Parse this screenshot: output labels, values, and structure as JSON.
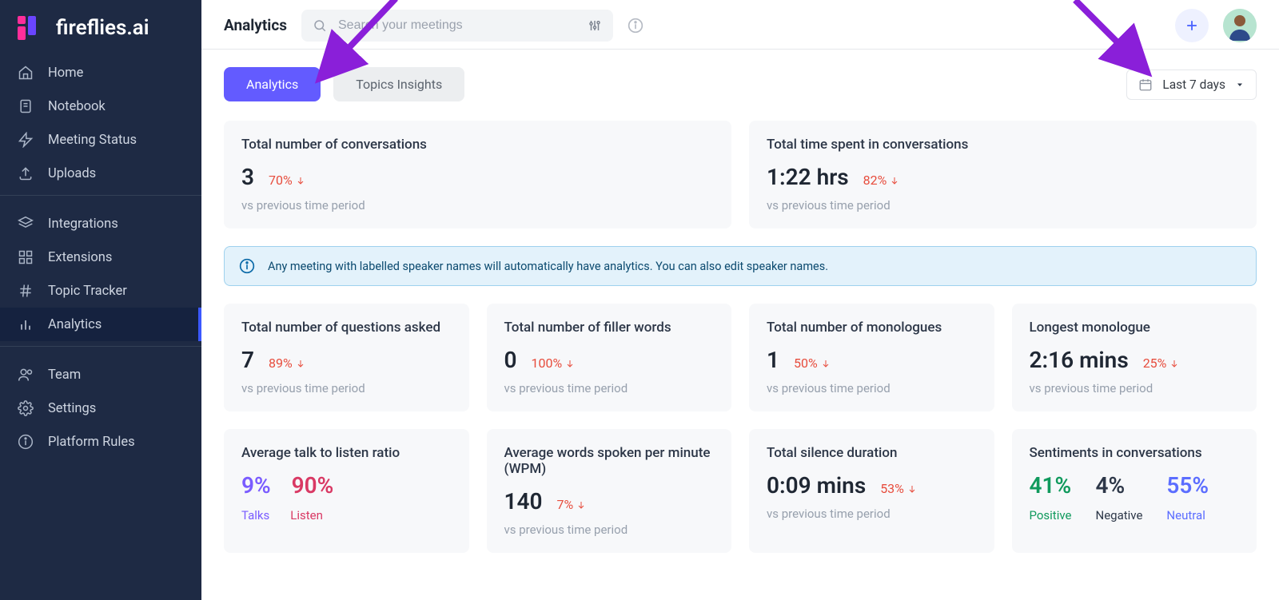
{
  "brand": "fireflies.ai",
  "header": {
    "title": "Analytics",
    "search_placeholder": "Search your meetings"
  },
  "sidebar": {
    "items": [
      {
        "label": "Home"
      },
      {
        "label": "Notebook"
      },
      {
        "label": "Meeting Status"
      },
      {
        "label": "Uploads"
      },
      {
        "label": "Integrations"
      },
      {
        "label": "Extensions"
      },
      {
        "label": "Topic Tracker"
      },
      {
        "label": "Analytics"
      },
      {
        "label": "Team"
      },
      {
        "label": "Settings"
      },
      {
        "label": "Platform Rules"
      }
    ]
  },
  "tabs": {
    "analytics": "Analytics",
    "topics": "Topics Insights"
  },
  "date_range": "Last 7 days",
  "info_banner": "Any meeting with labelled speaker names will automatically have analytics. You can also edit speaker names.",
  "sub_vs": "vs previous time period",
  "cards": {
    "conversations": {
      "title": "Total number of conversations",
      "value": "3",
      "delta": "70%"
    },
    "time": {
      "title": "Total time spent in conversations",
      "value": "1:22 hrs",
      "delta": "82%"
    },
    "questions": {
      "title": "Total number of questions asked",
      "value": "7",
      "delta": "89%"
    },
    "filler": {
      "title": "Total number of filler words",
      "value": "0",
      "delta": "100%"
    },
    "monologues": {
      "title": "Total number of monologues",
      "value": "1",
      "delta": "50%"
    },
    "longest": {
      "title": "Longest monologue",
      "value": "2:16 mins",
      "delta": "25%"
    },
    "ratio": {
      "title": "Average talk to listen ratio",
      "talks_pct": "9%",
      "listen_pct": "90%",
      "talks_label": "Talks",
      "listen_label": "Listen"
    },
    "wpm": {
      "title": "Average words spoken per minute (WPM)",
      "value": "140",
      "delta": "7%"
    },
    "silence": {
      "title": "Total silence duration",
      "value": "0:09 mins",
      "delta": "53%"
    },
    "sentiments": {
      "title": "Sentiments in conversations",
      "positive": "41%",
      "negative": "4%",
      "neutral": "55%",
      "positive_label": "Positive",
      "negative_label": "Negative",
      "neutral_label": "Neutral"
    }
  }
}
